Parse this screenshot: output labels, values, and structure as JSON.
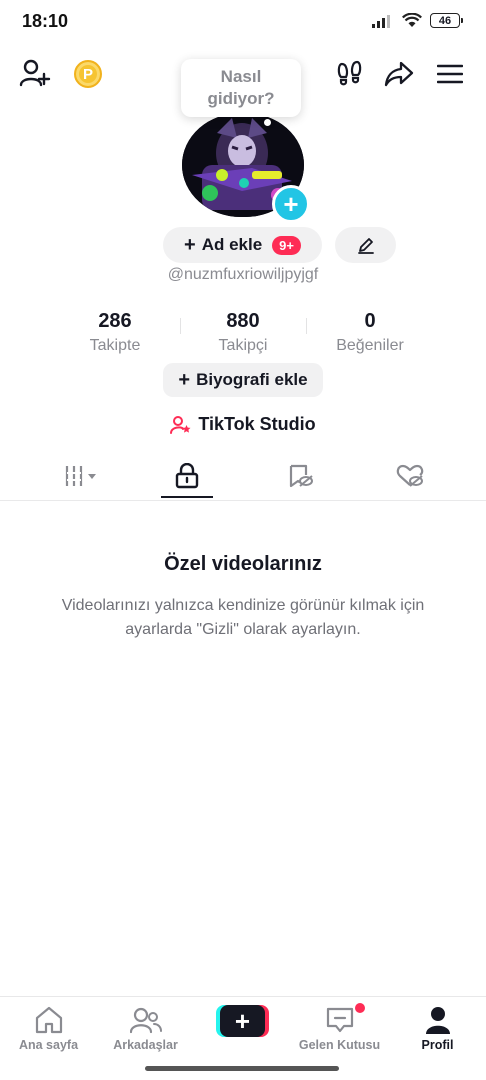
{
  "status_bar": {
    "time": "18:10",
    "battery": "46"
  },
  "header": {
    "coin_label": "P"
  },
  "bubble": {
    "line1": "Nasıl",
    "line2": "gidiyor?"
  },
  "profile": {
    "add_ad_label": "Ad ekle",
    "add_ad_badge": "9+",
    "username": "@nuzmfuxriowiljpyjgf"
  },
  "stats": [
    {
      "value": "286",
      "label": "Takipte"
    },
    {
      "value": "880",
      "label": "Takipçi"
    },
    {
      "value": "0",
      "label": "Beğeniler"
    }
  ],
  "bio_button": "Biyografi ekle",
  "studio_label": "TikTok Studio",
  "empty_state": {
    "title": "Özel videolarınız",
    "description": "Videolarınızı yalnızca kendinize görünür kılmak için ayarlarda \"Gizli\" olarak ayarlayın."
  },
  "bottom_nav": [
    {
      "label": "Ana sayfa"
    },
    {
      "label": "Arkadaşlar"
    },
    {
      "label": ""
    },
    {
      "label": "Gelen Kutusu"
    },
    {
      "label": "Profil"
    }
  ],
  "colors": {
    "accent": "#fe2c55",
    "cyan": "#25f4ee",
    "avatar_add": "#22c5e5"
  }
}
